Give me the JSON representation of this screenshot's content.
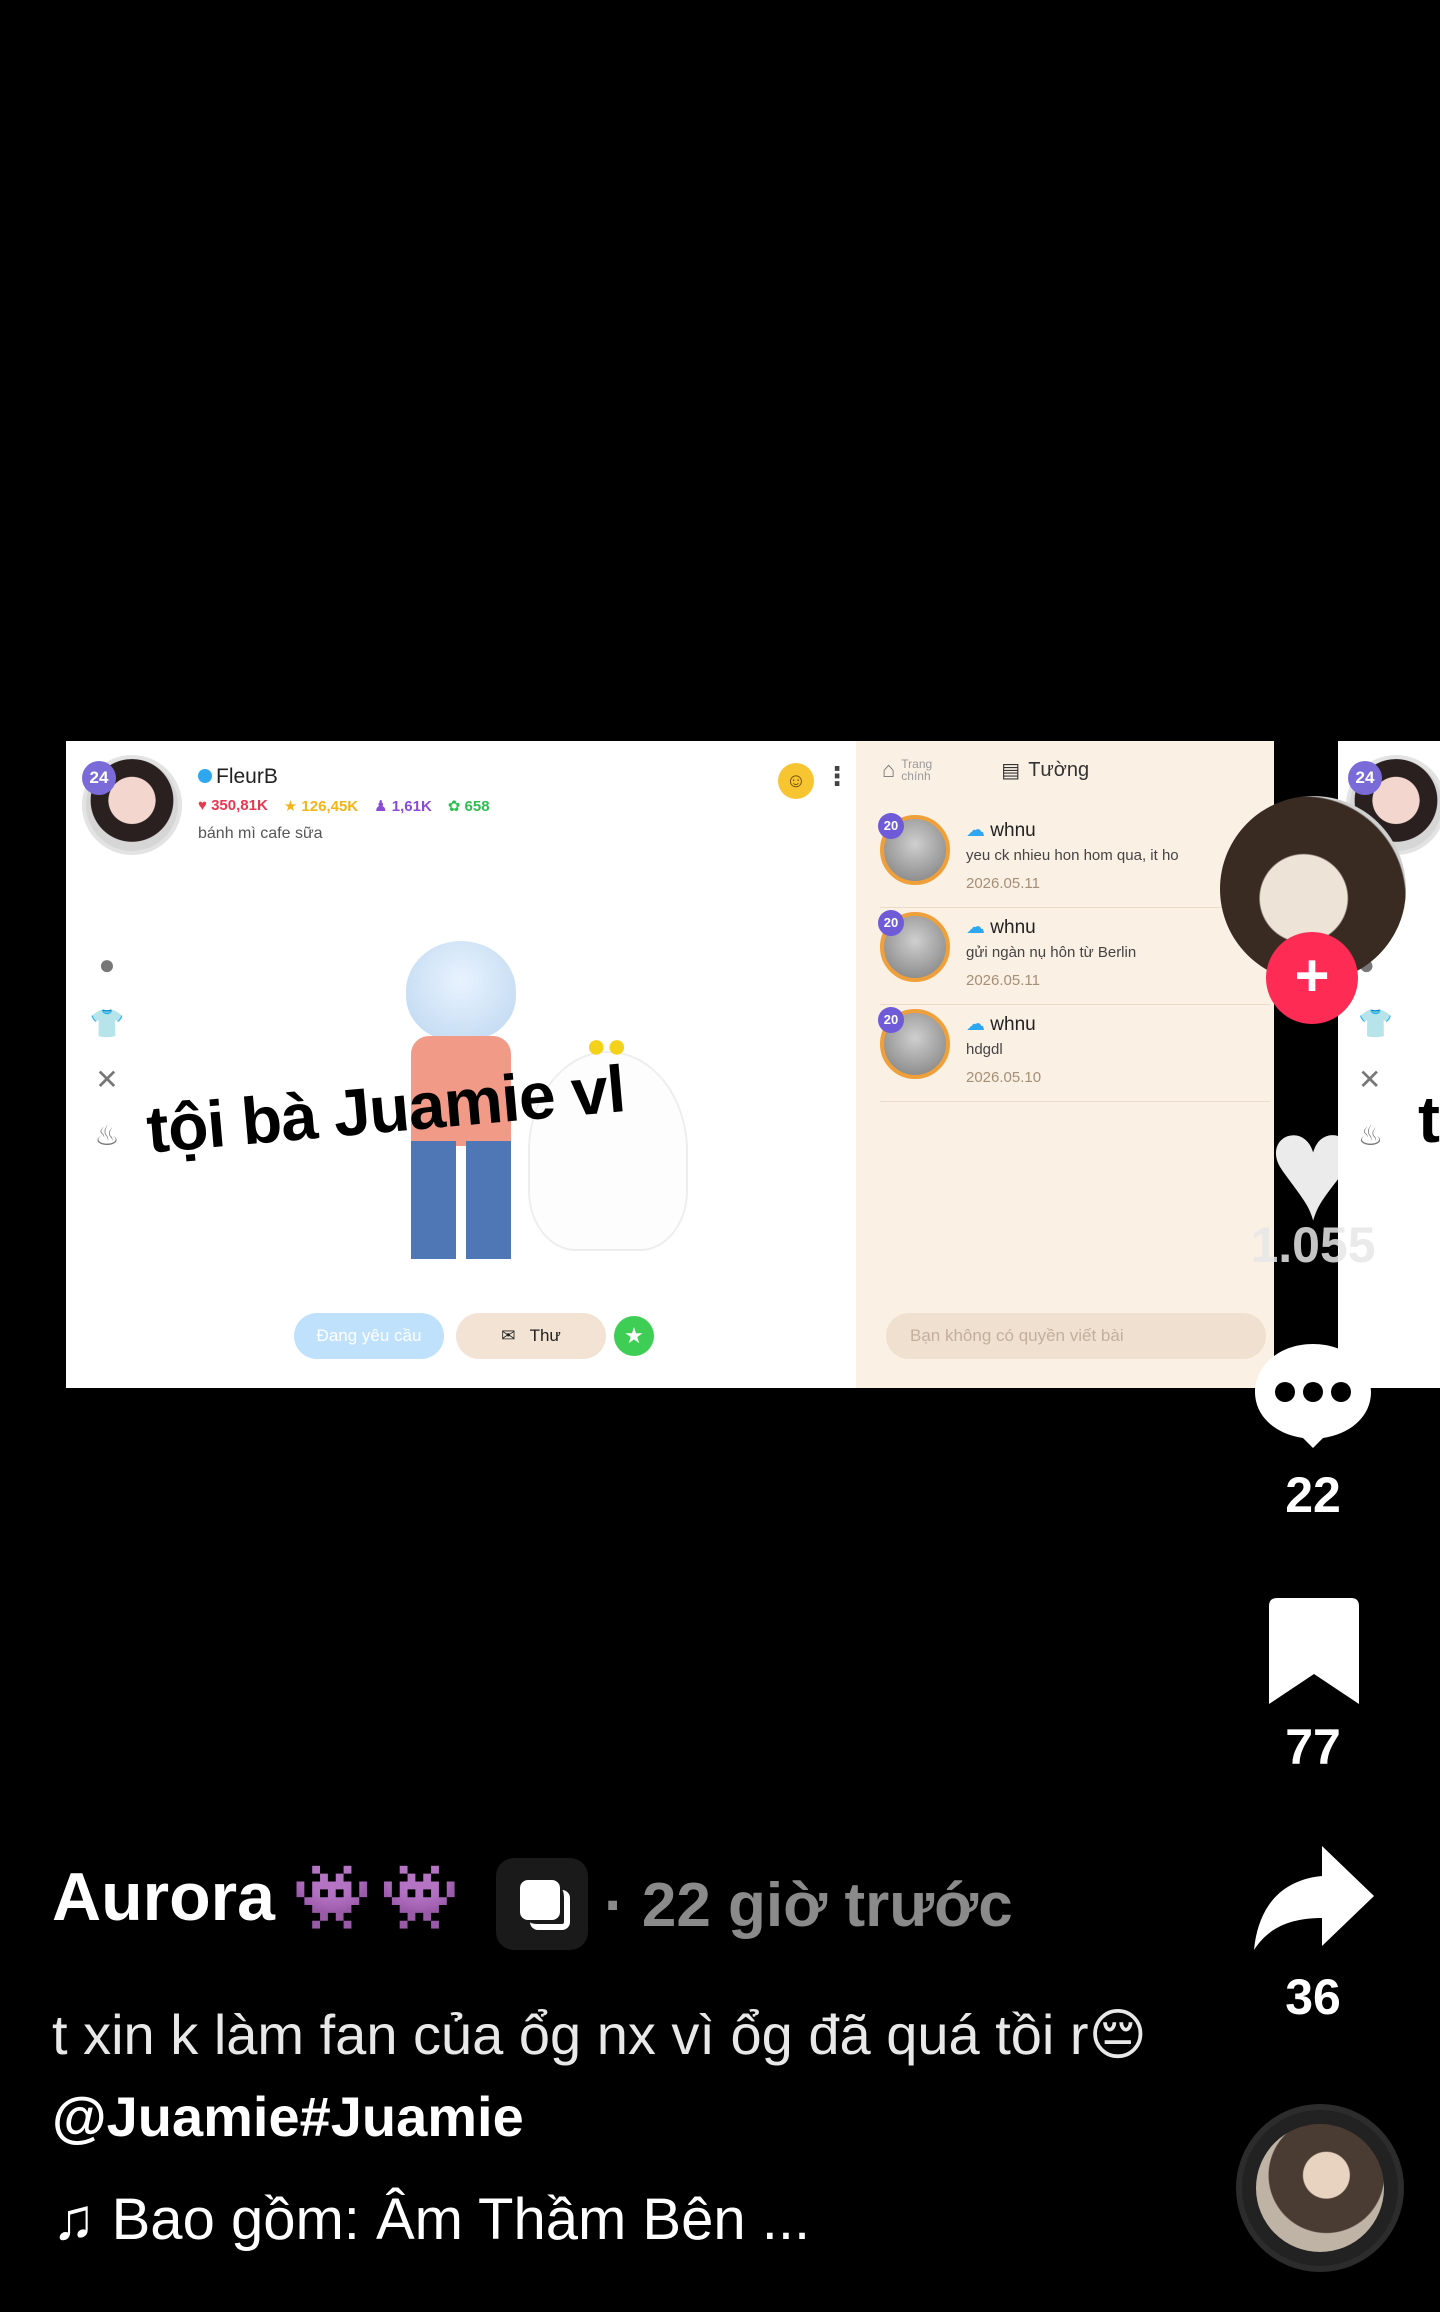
{
  "video_frame": {
    "overlay_text": "tội bà Juamie vl",
    "profile": {
      "level": "24",
      "name": "FleurB",
      "stats": [
        {
          "icon": "heart-icon",
          "value": "350,81K",
          "color": "#e53950"
        },
        {
          "icon": "star-icon",
          "value": "126,45K",
          "color": "#f3b419"
        },
        {
          "icon": "people-icon",
          "value": "1,61K",
          "color": "#8a4bd8"
        },
        {
          "icon": "clover-icon",
          "value": "658",
          "color": "#2dbf4f"
        }
      ],
      "bio": "bánh mì cafe sữa"
    },
    "buttons": {
      "request": "Đang yêu cầu",
      "mail": "Thư"
    },
    "tabs": {
      "home": "Trang chính",
      "wall": "Tường"
    },
    "posts": [
      {
        "level": "20",
        "name": "whnu",
        "text": "yeu ck nhieu hon hom qua, it ho",
        "date": "2026.05.11"
      },
      {
        "level": "20",
        "name": "whnu",
        "text": "gửi ngàn nụ hôn từ Berlin",
        "date": "2026.05.11"
      },
      {
        "level": "20",
        "name": "whnu",
        "text": "hdgdl",
        "date": "2026.05.10"
      }
    ],
    "no_permission": "Bạn không có quyền viết bài",
    "peek": {
      "level": "24",
      "text": "t"
    }
  },
  "rail": {
    "like_count": "1.055",
    "comment_count": "22",
    "bookmark_count": "77",
    "share_count": "36"
  },
  "post_info": {
    "author": "Aurora",
    "author_emoji": "👾👾",
    "time_ago": "· 22 giờ trước",
    "caption_text": "t xin k làm fan của ổg nx vì ổg đã quá tồi r😔",
    "mention": "@Juamie",
    "hashtag": "#Juamie",
    "music_icon": "♫",
    "music": "Bao gồm: Âm Thầm Bên ..."
  },
  "colors": {
    "background": "#000000",
    "follow_red": "#fe2c55",
    "time_gray": "#8a8a8a"
  }
}
